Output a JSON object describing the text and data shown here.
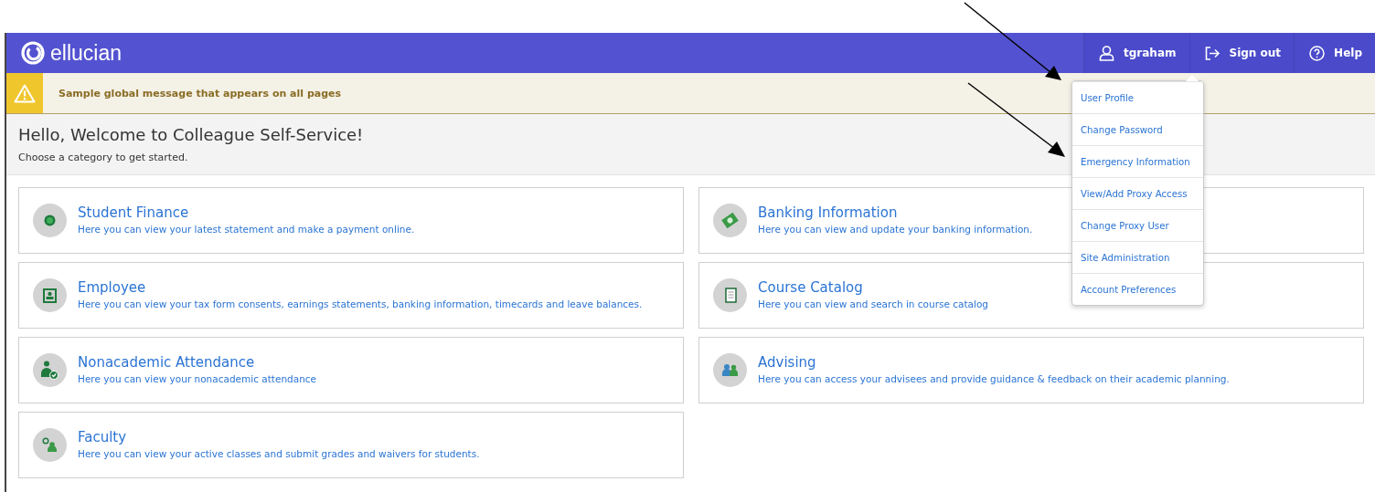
{
  "header": {
    "logo": "ellucian",
    "nav": [
      {
        "kind": "user",
        "label": "tgraham"
      },
      {
        "kind": "signout",
        "label": "Sign out"
      },
      {
        "kind": "help",
        "label": "Help"
      }
    ]
  },
  "banner": {
    "message": "Sample global message that appears on all pages"
  },
  "greeting": {
    "title": "Hello, Welcome to Colleague Self-Service!",
    "subtitle": "Choose a category to get started."
  },
  "cards": [
    {
      "title": "Student Finance",
      "description": "Here you can view your latest statement and make a payment online."
    },
    {
      "title": "Banking Information",
      "description": "Here you can view and update your banking information."
    },
    {
      "title": "Employee",
      "description": "Here you can view your tax form consents, earnings statements, banking information, timecards and leave balances."
    },
    {
      "title": "Course Catalog",
      "description": "Here you can view and search in course catalog"
    },
    {
      "title": "Nonacademic Attendance",
      "description": "Here you can view your nonacademic attendance"
    },
    {
      "title": "Advising",
      "description": "Here you can access your advisees and provide guidance & feedback on their academic planning."
    },
    {
      "title": "Faculty",
      "description": "Here you can view your active classes and submit grades and waivers for students."
    }
  ],
  "user_menu": {
    "items": [
      "User Profile",
      "Change Password",
      "Emergency Information",
      "View/Add Proxy Access",
      "Change Proxy User",
      "Site Administration",
      "Account Preferences"
    ]
  }
}
